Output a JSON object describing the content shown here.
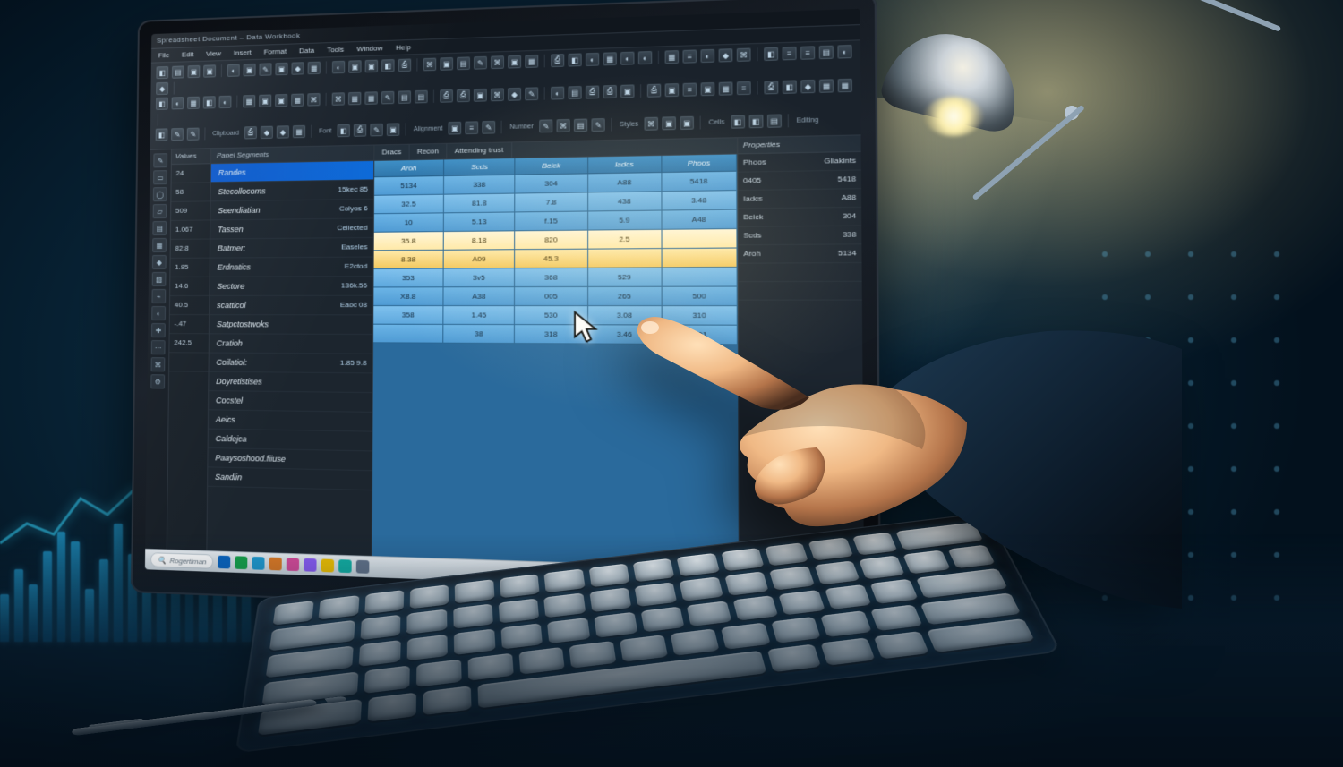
{
  "titlebar": "Spreadsheet Document – Data Workbook",
  "menubar": [
    "File",
    "Edit",
    "View",
    "Insert",
    "Format",
    "Data",
    "Tools",
    "Window",
    "Help"
  ],
  "ribbon_labels": [
    "Clipboard",
    "Font",
    "Alignment",
    "Number",
    "Styles",
    "Cells",
    "Editing"
  ],
  "iconstrip_glyphs": [
    "✎",
    "▭",
    "◯",
    "▱",
    "▤",
    "▦",
    "◆",
    "▧",
    "⌁",
    "◐",
    "✚",
    "⋯",
    "⌘",
    "⚙"
  ],
  "numbers_header": "Values",
  "numbers": [
    "24",
    "58",
    "509",
    "1.067",
    "82.8",
    "1.85",
    "14.6",
    "40.5",
    "-.47",
    "242.5",
    ""
  ],
  "categories_header": "Panel Segments",
  "categories": [
    {
      "name": "Randes",
      "value": "",
      "sel": true
    },
    {
      "name": "Stecollocoms",
      "value": "15kec 85"
    },
    {
      "name": "Seendiatian",
      "value": "Colyos 6"
    },
    {
      "name": "Tassen",
      "value": "Cellected"
    },
    {
      "name": "Batmer:",
      "value": "Easeles"
    },
    {
      "name": "Erdnatics",
      "value": "E2ctod"
    },
    {
      "name": "Sectore",
      "value": "136k.56"
    },
    {
      "name": "scatticol",
      "value": "Eaoc 08"
    },
    {
      "name": "Satpctostwoks",
      "value": ""
    },
    {
      "name": "Cratioh",
      "value": ""
    },
    {
      "name": "Coilatiol:",
      "value": "1.85 9.8"
    },
    {
      "name": "Doyretistises",
      "value": ""
    },
    {
      "name": "Cocstel",
      "value": ""
    },
    {
      "name": "Aeics",
      "value": ""
    },
    {
      "name": "Caldejca",
      "value": ""
    },
    {
      "name": "Paaysoshood.fiiuse",
      "value": ""
    },
    {
      "name": "Sandlin",
      "value": ""
    }
  ],
  "grid_tabs": [
    "Dracs",
    "Recon",
    "Attending trust"
  ],
  "grid_headers": [
    "Aroh",
    "Scds",
    "Beick",
    "Iadcs",
    "Phoos"
  ],
  "grid_rows": [
    [
      "5134",
      "338",
      "304",
      "A88",
      "5418"
    ],
    [
      "32.5",
      "81.8",
      "7.8",
      "438",
      "3.48"
    ],
    [
      "10",
      "5.13",
      "f.15",
      "5.9",
      "A48"
    ],
    [
      "35.8",
      "8.18",
      "820",
      "2.5",
      ""
    ],
    [
      "8.38",
      "A09",
      "45.3",
      "",
      ""
    ],
    [
      "353",
      "3v5",
      "368",
      "529",
      ""
    ],
    [
      "X8.8",
      "A38",
      "005",
      "265",
      "500"
    ],
    [
      "358",
      "1.45",
      "530",
      "3.08",
      "310"
    ],
    [
      "",
      "38",
      "318",
      "3.46",
      "5.01"
    ]
  ],
  "props_header": "Properties",
  "props": [
    {
      "k": "Phoos",
      "v": "Gliakints"
    },
    {
      "k": "0405",
      "v": "5418"
    },
    {
      "k": "Iadcs",
      "v": "A88"
    },
    {
      "k": "Beick",
      "v": "304"
    },
    {
      "k": "Scds",
      "v": "338"
    },
    {
      "k": "Aroh",
      "v": "5134"
    },
    {
      "k": "",
      "v": ""
    },
    {
      "k": "",
      "v": ""
    }
  ],
  "taskbar": {
    "search_placeholder": "Rogertiman",
    "app_colors": [
      "#0a66c2",
      "#17a34a",
      "#1f9bd1",
      "#e07b24",
      "#d94b9b",
      "#8b5cf6",
      "#f2c200",
      "#13b1a5",
      "#64748b"
    ]
  },
  "bg_bar_heights": [
    38,
    58,
    46,
    72,
    88,
    80,
    42,
    66,
    94,
    70,
    48,
    82,
    60,
    90,
    52,
    76,
    44,
    68
  ],
  "bg_line_points": "0,80 30,58 60,70 90,30 120,48 150,20 180,42 210,10 240,34 260,18"
}
